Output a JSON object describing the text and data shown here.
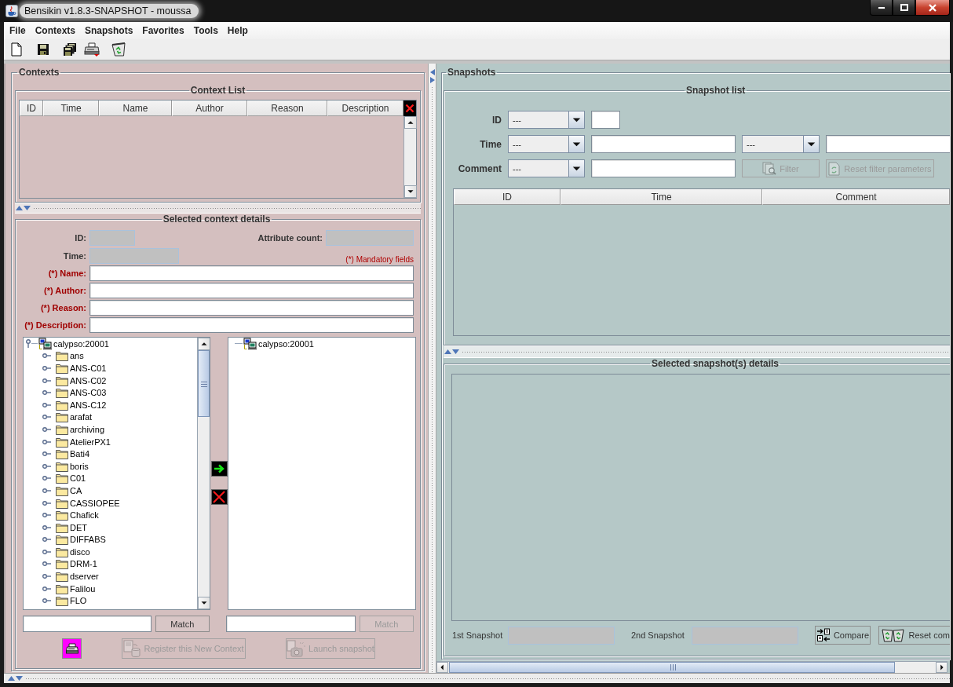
{
  "window": {
    "title": "Bensikin v1.8.3-SNAPSHOT - moussa"
  },
  "menu": [
    "File",
    "Contexts",
    "Snapshots",
    "Favorites",
    "Tools",
    "Help"
  ],
  "contexts": {
    "title": "Contexts",
    "context_list": {
      "title": "Context List",
      "columns": [
        "ID",
        "Time",
        "Name",
        "Author",
        "Reason",
        "Description"
      ]
    },
    "details": {
      "title": "Selected context details",
      "id": {
        "label": "ID:",
        "disabled": true
      },
      "attribute_count": {
        "label": "Attribute count:",
        "disabled": true
      },
      "time": {
        "label": "Time:",
        "disabled": true
      },
      "mandatory_note": "(*) Mandatory fields",
      "fields": [
        {
          "label": "(*) Name:",
          "required": true
        },
        {
          "label": "(*) Author:",
          "required": true
        },
        {
          "label": "(*) Reason:",
          "required": true
        },
        {
          "label": "(*) Description:",
          "required": true
        }
      ]
    },
    "available_tree": {
      "label": "calypso:20001",
      "expanded": true,
      "children": [
        {
          "label": "ans",
          "expanded": false
        },
        {
          "label": "ANS-C01",
          "expanded": false
        },
        {
          "label": "ANS-C02",
          "expanded": false
        },
        {
          "label": "ANS-C03",
          "expanded": false
        },
        {
          "label": "ANS-C12",
          "expanded": false
        },
        {
          "label": "arafat",
          "expanded": false
        },
        {
          "label": "archiving",
          "expanded": false
        },
        {
          "label": "AtelierPX1",
          "expanded": false
        },
        {
          "label": "Bati4",
          "expanded": false
        },
        {
          "label": "boris",
          "expanded": false
        },
        {
          "label": "C01",
          "expanded": false
        },
        {
          "label": "CA",
          "expanded": false
        },
        {
          "label": "CASSIOPEE",
          "expanded": false
        },
        {
          "label": "Chafick",
          "expanded": false
        },
        {
          "label": "DET",
          "expanded": false
        },
        {
          "label": "DIFFABS",
          "expanded": false
        },
        {
          "label": "disco",
          "expanded": false
        },
        {
          "label": "DRM-1",
          "expanded": false
        },
        {
          "label": "dserver",
          "expanded": false
        },
        {
          "label": "Falilou",
          "expanded": false
        },
        {
          "label": "FLO",
          "expanded": false
        }
      ]
    },
    "selected_tree": {
      "label": "calypso:20001"
    },
    "available_match": {
      "label": "Match",
      "disabled": false
    },
    "selected_match": {
      "label": "Match",
      "disabled": true
    },
    "register_button": {
      "label": "Register this New Context",
      "disabled": true
    },
    "launch_button": {
      "label": "Launch snapshot",
      "disabled": true
    }
  },
  "snapshots": {
    "title": "Snapshots",
    "snapshot_list": {
      "title": "Snapshot list",
      "filters": [
        {
          "kind": "id",
          "label": "ID",
          "operator": "---"
        },
        {
          "kind": "time",
          "label": "Time",
          "operator": "---",
          "second_operator": "---"
        },
        {
          "kind": "comment",
          "label": "Comment",
          "operator": "---"
        }
      ],
      "filter_button": {
        "label": "Filter",
        "disabled": true
      },
      "reset_button": {
        "label": "Reset filter parameters",
        "disabled": true
      },
      "columns": [
        "ID",
        "Time",
        "Comment"
      ]
    },
    "details": {
      "title": "Selected snapshot(s) details",
      "first_snapshot": {
        "label": "1st Snapshot",
        "disabled": true
      },
      "second_snapshot": {
        "label": "2nd Snapshot",
        "disabled": true
      },
      "compare_button": {
        "label": "Compare",
        "disabled": false
      },
      "reset_button": {
        "label": "Reset com",
        "disabled": false
      }
    }
  }
}
